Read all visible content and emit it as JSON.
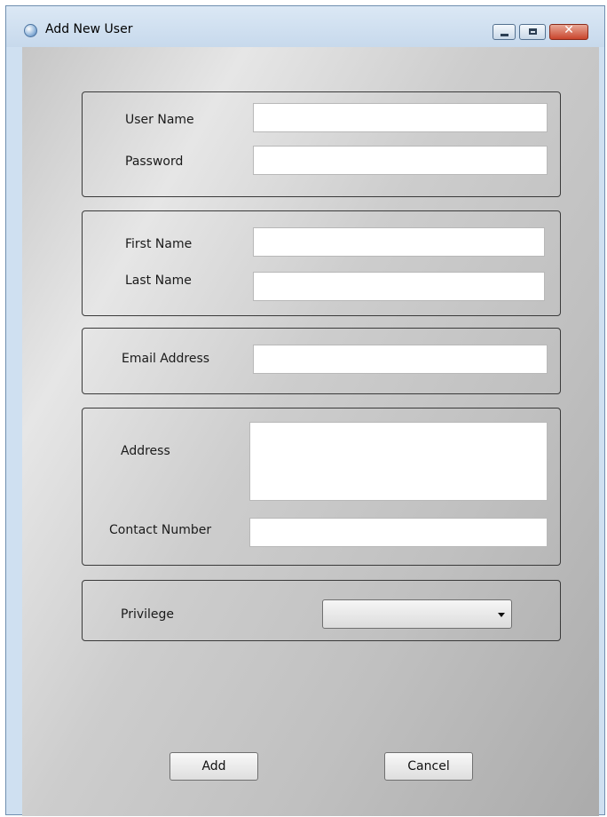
{
  "window": {
    "title": "Add New User",
    "controls": {
      "minimize_icon": "minimize-icon",
      "maximize_icon": "maximize-icon",
      "close_icon": "close-icon",
      "close_glyph": "✕"
    }
  },
  "account": {
    "username_label": "User Name",
    "username_value": "",
    "password_label": "Password",
    "password_value": ""
  },
  "name": {
    "first_name_label": "First Name",
    "first_name_value": "",
    "last_name_label": "Last Name",
    "last_name_value": ""
  },
  "email": {
    "label": "Email Address",
    "value": ""
  },
  "contact": {
    "address_label": "Address",
    "address_value": "",
    "contact_number_label": "Contact Number",
    "contact_number_value": ""
  },
  "privilege": {
    "label": "Privilege",
    "selected": ""
  },
  "actions": {
    "add_label": "Add",
    "cancel_label": "Cancel"
  },
  "colors": {
    "titlebar": "#cfe0f1",
    "close_button": "#c9452c",
    "group_border": "#3a3a3a",
    "field_background": "#ffffff"
  }
}
